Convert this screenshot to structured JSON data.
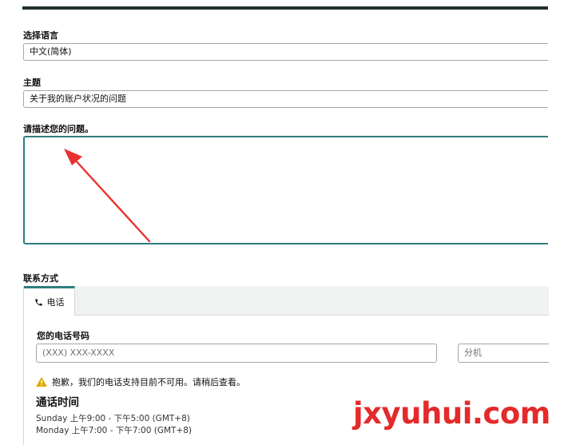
{
  "form": {
    "language": {
      "label": "选择语言",
      "value": "中文(简体)"
    },
    "subject": {
      "label": "主题",
      "value": "关于我的账户状况的问题"
    },
    "description": {
      "label": "请描述您的问题。",
      "value": ""
    }
  },
  "contact": {
    "section_label": "联系方式",
    "tabs": [
      {
        "label": "电话",
        "icon": "phone-icon"
      }
    ],
    "phone_label": "您的电话号码",
    "phone_placeholder": "(XXX) XXX-XXXX",
    "ext_placeholder": "分机",
    "warning": {
      "icon": "warning-icon",
      "text": "抱歉，我们的电话支持目前不可用。请稍后查看。"
    },
    "hours_title": "通话时间",
    "hours": [
      "Sunday 上午9:00 - 下午5:00 (GMT+8)",
      "Monday 上午7:00 - 下午7:00 (GMT+8)"
    ]
  },
  "watermark": "jxyuhui.com",
  "colors": {
    "accent": "#2f7d7f",
    "annotation_arrow": "#e8322f",
    "warning": "#e0a600"
  }
}
